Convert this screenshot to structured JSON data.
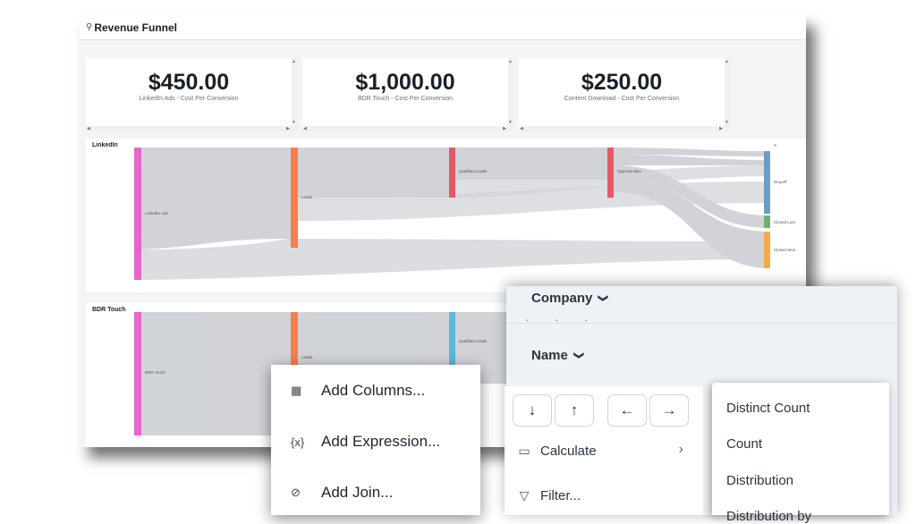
{
  "dashboard": {
    "title": "Revenue Funnel",
    "title_icon": "telescope-icon",
    "kpis": [
      {
        "value": "$450.00",
        "label": "LinkedIn Ads - Cost Per Conversion"
      },
      {
        "value": "$1,000.00",
        "label": "BDR Touch - Cost Per Conversion"
      },
      {
        "value": "$250.00",
        "label": "Content Download - Cost Per Conversion"
      }
    ],
    "linkedin": {
      "title": "LinkedIn",
      "nodes": {
        "source": "LinkedIn Ads",
        "leads": "Leads",
        "qualified": "Qualified Leads",
        "opportunities": "Opportunities",
        "x": "X",
        "dropoff": "Dropoff",
        "closed_lost": "Closed Lost",
        "closed_won": "Closed Won"
      }
    },
    "bdr": {
      "title": "BDR Touch",
      "nodes": {
        "source": "BDR Touch",
        "leads": "Leads",
        "qualified": "Qualified Leads"
      }
    },
    "colors": {
      "source": "#e667c9",
      "leads": "#f4804e",
      "qualified": "#e35a66",
      "qualified_bdr": "#5ab8dd",
      "dropoff": "#6f9cc4",
      "closed_lost": "#6bb36f",
      "closed_won": "#f5a94a",
      "flow": "#c9ccd1"
    }
  },
  "column_menu": {
    "fields": [
      "Company",
      "Name"
    ],
    "arrows": [
      "↓",
      "↑",
      "←",
      "→"
    ],
    "ops": [
      {
        "label": "Calculate",
        "icon": "calculator-icon"
      },
      {
        "label": "Filter...",
        "icon": "filter-icon"
      }
    ],
    "submenu": [
      "Distinct Count",
      "Count",
      "Distribution",
      "Distribution by"
    ]
  },
  "add_menu": {
    "items": [
      {
        "label": "Add Columns...",
        "icon": "columns-icon"
      },
      {
        "label": "Add Expression...",
        "icon": "expression-icon"
      },
      {
        "label": "Add Join...",
        "icon": "link-icon"
      }
    ]
  }
}
